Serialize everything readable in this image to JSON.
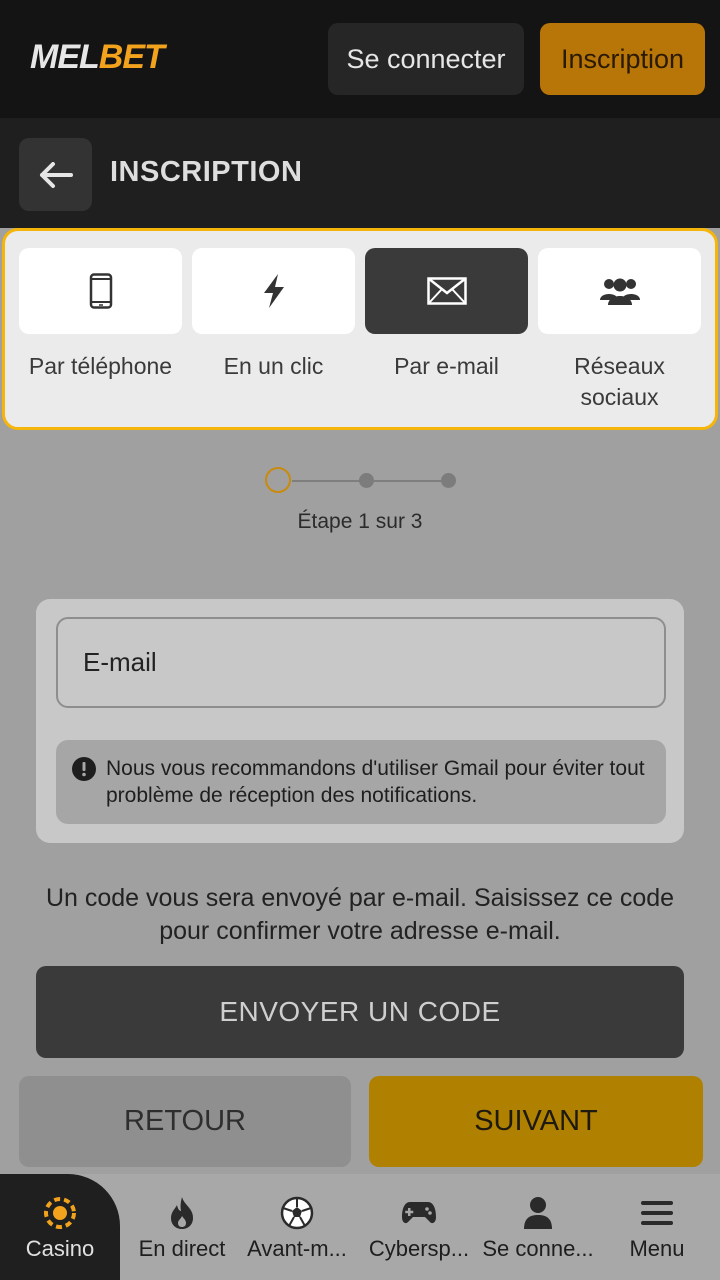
{
  "header": {
    "logo_part1": "MEL",
    "logo_part2": "BET",
    "login_label": "Se connecter",
    "register_label": "Inscription"
  },
  "subheader": {
    "title": "INSCRIPTION"
  },
  "tabs": [
    {
      "label": "Par téléphone",
      "icon": "phone-icon",
      "active": false
    },
    {
      "label": "En un clic",
      "icon": "lightning-icon",
      "active": false
    },
    {
      "label": "Par e-mail",
      "icon": "envelope-icon",
      "active": true
    },
    {
      "label": "Réseaux sociaux",
      "icon": "users-icon",
      "active": false
    }
  ],
  "stepper": {
    "text": "Étape 1 sur 3",
    "current": 1,
    "total": 3
  },
  "form": {
    "email_placeholder": "E-mail",
    "notice": "Nous vous recommandons d'utiliser Gmail pour éviter tout problème de réception des notifications."
  },
  "info_text": "Un code vous sera envoyé par e-mail. Saisissez ce code pour confirmer votre adresse e-mail.",
  "actions": {
    "send_code": "ENVOYER UN CODE",
    "back": "RETOUR",
    "next": "SUIVANT"
  },
  "bottom_nav": [
    {
      "label": "Casino",
      "icon": "casino-chip-icon",
      "active": true
    },
    {
      "label": "En direct",
      "icon": "flame-icon",
      "active": false
    },
    {
      "label": "Avant-m...",
      "icon": "soccer-ball-icon",
      "active": false
    },
    {
      "label": "Cybersp...",
      "icon": "gamepad-icon",
      "active": false
    },
    {
      "label": "Se conne...",
      "icon": "user-icon",
      "active": false
    },
    {
      "label": "Menu",
      "icon": "hamburger-icon",
      "active": false
    }
  ],
  "colors": {
    "accent": "#f5b50a",
    "brand_orange": "#b87508",
    "next_button": "#b08000",
    "header_bg": "#141414"
  }
}
